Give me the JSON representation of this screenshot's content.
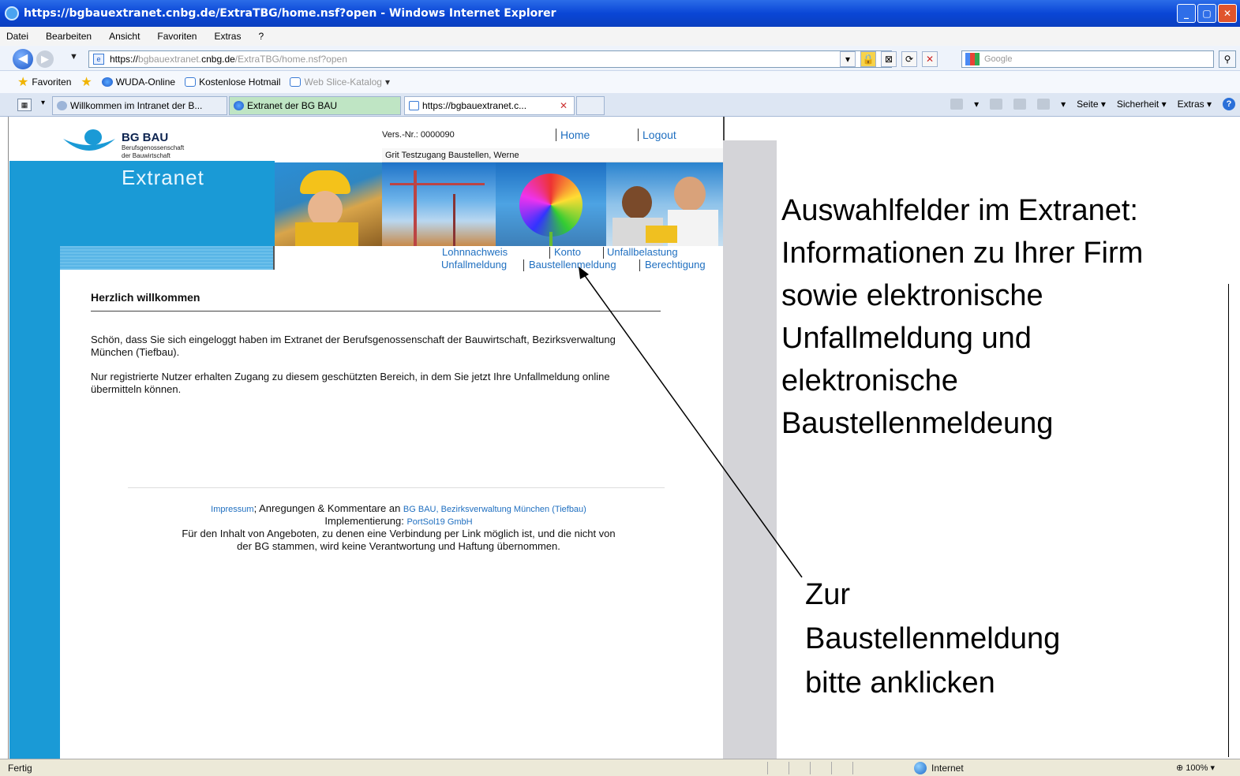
{
  "window": {
    "title": "https://bgbauextranet.cnbg.de/ExtraTBG/home.nsf?open - Windows Internet Explorer"
  },
  "menubar": [
    "Datei",
    "Bearbeiten",
    "Ansicht",
    "Favoriten",
    "Extras",
    "?"
  ],
  "address": {
    "scheme": "https://",
    "pre": "bgbauextranet.",
    "domain": "cnbg.de",
    "path": "/ExtraTBG/home.nsf?open"
  },
  "search": {
    "placeholder": "Google"
  },
  "favorites": {
    "label": "Favoriten",
    "items": [
      "WUDA-Online",
      "Kostenlose Hotmail",
      "Web Slice-Katalog"
    ]
  },
  "tabs": [
    {
      "label": "Willkommen im Intranet der B..."
    },
    {
      "label": "Extranet der BG BAU"
    },
    {
      "label": "https://bgbauextranet.c..."
    }
  ],
  "command_bar": [
    "Seite",
    "Sicherheit",
    "Extras"
  ],
  "site": {
    "brand": "BG BAU",
    "brand_sub1": "Berufsgenossenschaft",
    "brand_sub2": "der Bauwirtschaft",
    "extranet": "Extranet",
    "version": "Vers.-Nr.: 0000090",
    "home": "Home",
    "logout": "Logout",
    "user": "Grit Testzugang Baustellen, Werne",
    "nav_row1": [
      "Lohnnachweis",
      "Konto",
      "Unfallbelastung"
    ],
    "nav_row2": [
      "Unfallmeldung",
      "Baustellenmeldung",
      "Berechtigung"
    ],
    "welcome_title": "Herzlich willkommen",
    "para1": "Schön, dass Sie sich eingeloggt haben im Extranet der Berufsgenossenschaft der Bauwirtschaft, Bezirksverwaltung München (Tiefbau).",
    "para2": "Nur registrierte Nutzer erhalten Zugang zu diesem geschützten Bereich, in dem Sie jetzt Ihre Unfallmeldung online übermitteln können.",
    "footer": {
      "impressum": "Impressum",
      "sep1": ";",
      "anregungen": " Anregungen & Kommentare an ",
      "bgbau_link": "BG BAU, Bezirksverwaltung München (Tiefbau)",
      "impl": "Implementierung: ",
      "impl_link": "PortSol19 GmbH",
      "line3": "Für den Inhalt von Angeboten, zu denen eine Verbindung per Link möglich ist, und die nicht von",
      "line4": "der BG stammen, wird keine Verantwortung und Haftung übernommen."
    }
  },
  "annotation": {
    "lines": [
      "Auswahlfelder im Extranet:",
      "Informationen zu Ihrer Firm",
      "sowie elektronische",
      "Unfallmeldung und",
      "elektronische",
      "Baustellenmeldeung"
    ],
    "callout": [
      "Zur",
      "Baustellenmeldung",
      "bitte anklicken"
    ]
  },
  "status": {
    "text": "Fertig",
    "zone": "Internet",
    "zoom": "100%"
  }
}
